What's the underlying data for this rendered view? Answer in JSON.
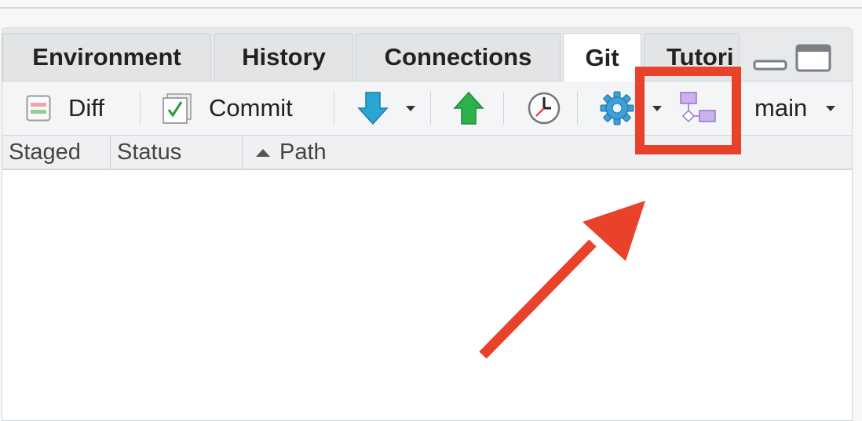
{
  "tabs": [
    {
      "label": "Environment",
      "active": false
    },
    {
      "label": "History",
      "active": false
    },
    {
      "label": "Connections",
      "active": false
    },
    {
      "label": "Git",
      "active": true
    },
    {
      "label": "Tutori",
      "active": false
    }
  ],
  "toolbar": {
    "diff_label": "Diff",
    "commit_label": "Commit",
    "branch_label": "main",
    "icons": [
      "diff-icon",
      "commit-checkbox-icon",
      "pull-arrow-icon",
      "push-arrow-icon",
      "history-clock-icon",
      "gear-icon",
      "branch-diagram-icon"
    ]
  },
  "columns": {
    "staged": "Staged",
    "status": "Status",
    "path": "Path",
    "sort_indicator": "ascending"
  },
  "colors": {
    "highlight": "#e8422a",
    "pull": "#2aa6d4",
    "push": "#2bb34a",
    "branch_icon": "#a987d6"
  }
}
